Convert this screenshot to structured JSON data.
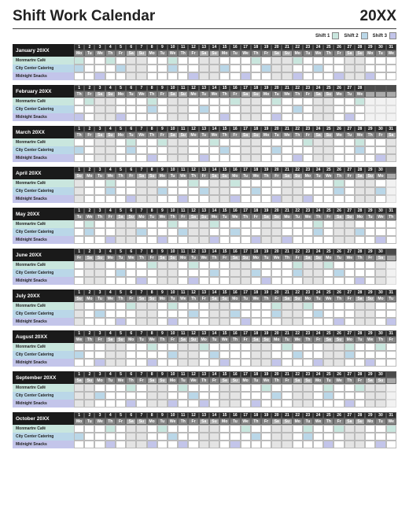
{
  "header": {
    "title": "Shift Work Calendar",
    "year": "20XX"
  },
  "legend": {
    "items": [
      {
        "label": "Shift 1",
        "color": "#c9e6de"
      },
      {
        "label": "Shift 2",
        "color": "#bad7e8"
      },
      {
        "label": "Shift 3",
        "color": "#c3c5ea"
      }
    ]
  },
  "shift_rows": [
    {
      "label": "Monmartre Café",
      "class": "r1"
    },
    {
      "label": "City Center Catering",
      "class": "r2"
    },
    {
      "label": "Midnight Snacks",
      "class": "r3"
    }
  ],
  "dow": [
    "Mo",
    "Tu",
    "We",
    "Th",
    "Fr",
    "Sa",
    "Su"
  ],
  "months": [
    {
      "name": "January 20XX",
      "days": 31,
      "start": 0
    },
    {
      "name": "February 20XX",
      "days": 28,
      "start": 3
    },
    {
      "name": "March 20XX",
      "days": 31,
      "start": 3
    },
    {
      "name": "April 20XX",
      "days": 30,
      "start": 6
    },
    {
      "name": "May 20XX",
      "days": 31,
      "start": 1
    },
    {
      "name": "June 20XX",
      "days": 30,
      "start": 4
    },
    {
      "name": "July 20XX",
      "days": 31,
      "start": 6
    },
    {
      "name": "August 20XX",
      "days": 31,
      "start": 2
    },
    {
      "name": "September 20XX",
      "days": 30,
      "start": 5
    },
    {
      "name": "October 20XX",
      "days": 31,
      "start": 0
    }
  ],
  "marks_pattern": {
    "1": [
      2,
      5,
      11,
      14,
      19,
      23,
      28
    ],
    "2": [
      3,
      7,
      12,
      17,
      21,
      26,
      30
    ],
    "3": [
      1,
      6,
      10,
      15,
      20,
      25,
      29
    ]
  }
}
